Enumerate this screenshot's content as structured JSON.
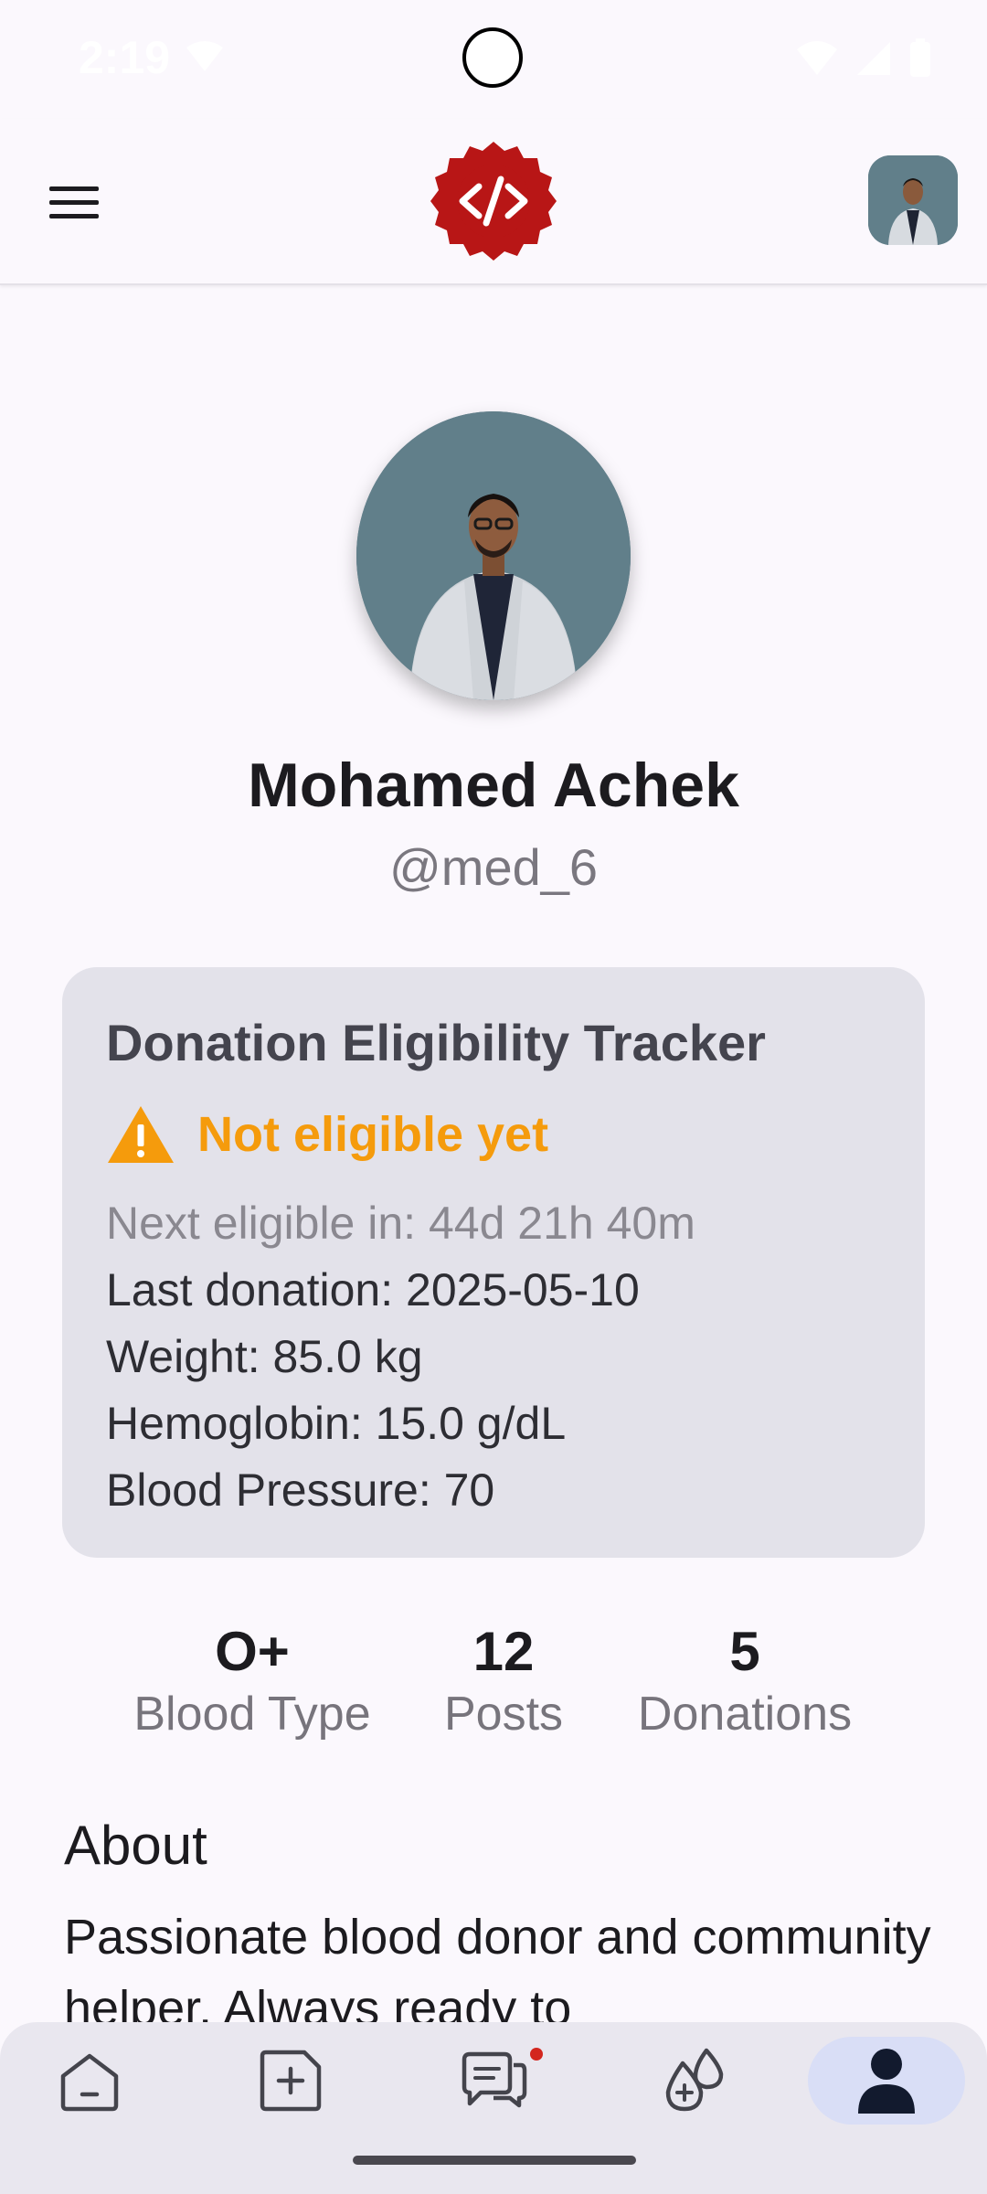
{
  "status_bar": {
    "time": "2:19"
  },
  "app_bar": {
    "logo_glyph": "</>"
  },
  "profile": {
    "name": "Mohamed Achek",
    "handle": "@med_6"
  },
  "eligibility": {
    "title": "Donation Eligibility Tracker",
    "status": "Not eligible yet",
    "next_eligible": "Next eligible in: 44d 21h 40m",
    "last_donation": "Last donation: 2025-05-10",
    "weight": "Weight: 85.0 kg",
    "hemoglobin": "Hemoglobin: 15.0 g/dL",
    "blood_pressure": "Blood Pressure: 70"
  },
  "stats": [
    {
      "value": "O+",
      "label": "Blood Type"
    },
    {
      "value": "12",
      "label": "Posts"
    },
    {
      "value": "5",
      "label": "Donations"
    }
  ],
  "about": {
    "title": "About",
    "text": "Passionate blood donor and community helper. Always ready to"
  },
  "bottom_nav": {
    "items": [
      {
        "icon": "home-icon"
      },
      {
        "icon": "add-post-icon"
      },
      {
        "icon": "chat-icon"
      },
      {
        "icon": "donate-blood-icon"
      },
      {
        "icon": "profile-icon"
      }
    ],
    "active_index": 4
  },
  "colors": {
    "warning": "#f59b0c",
    "logo_red": "#b81616",
    "card_bg": "#e3e2ea",
    "nav_active": "#d9def6"
  }
}
